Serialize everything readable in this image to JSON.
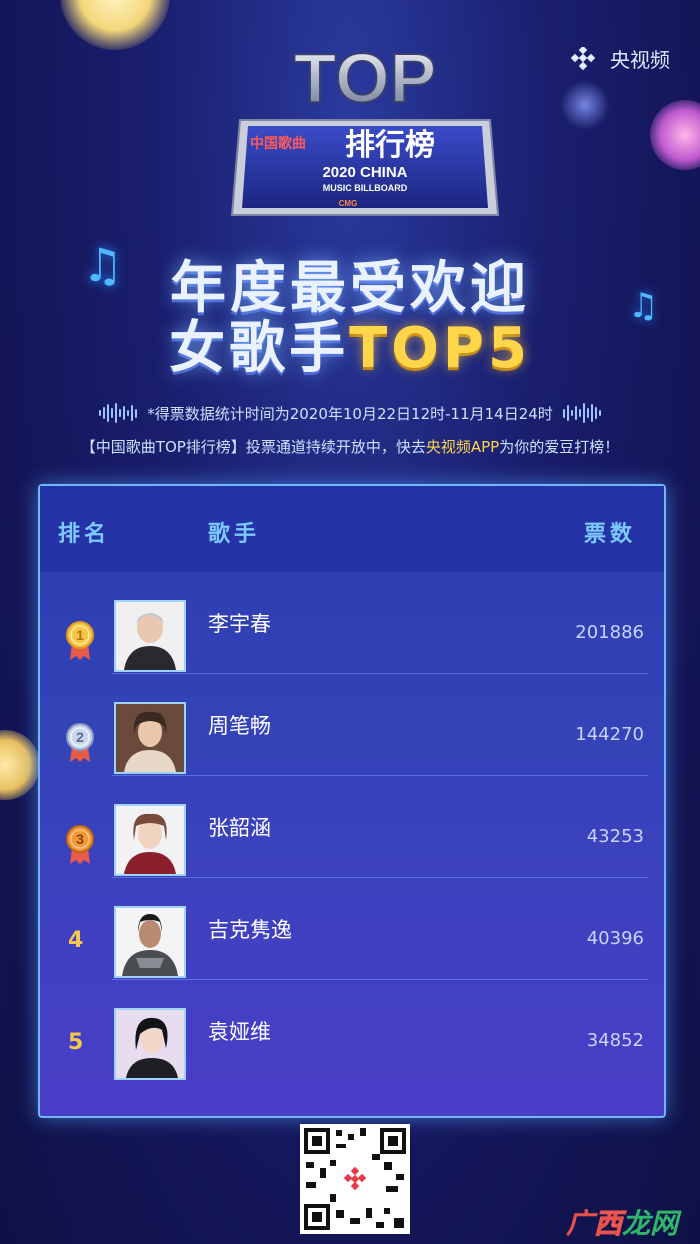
{
  "brand": {
    "name": "央视频",
    "icon": "cctv-video-logo-icon"
  },
  "logo": {
    "top": "TOP",
    "subtitle_small": "中国歌曲",
    "subtitle_big": "排行榜",
    "year_line": "2020 CHINA",
    "en_line": "MUSIC BILLBOARD",
    "org": "CMG"
  },
  "title": {
    "line1": "年度最受欢迎",
    "line2_prefix": "女歌手",
    "line2_highlight": "TOP5"
  },
  "stat_note": "*得票数据统计时间为2020年10月22日12时-11月14日24时",
  "promo": {
    "prefix": "【中国歌曲TOP排行榜】投票通道持续开放中，快去",
    "highlight": "央视频APP",
    "suffix": "为你的爱豆打榜！"
  },
  "table": {
    "headers": {
      "rank": "排名",
      "singer": "歌手",
      "votes": "票数"
    },
    "rows": [
      {
        "rank": "1",
        "name": "李宇春",
        "votes": "201886",
        "medal": "gold"
      },
      {
        "rank": "2",
        "name": "周笔畅",
        "votes": "144270",
        "medal": "silver"
      },
      {
        "rank": "3",
        "name": "张韶涵",
        "votes": "43253",
        "medal": "bronze"
      },
      {
        "rank": "4",
        "name": "吉克隽逸",
        "votes": "40396",
        "medal": ""
      },
      {
        "rank": "5",
        "name": "袁娅维",
        "votes": "34852",
        "medal": ""
      }
    ]
  },
  "watermark": {
    "c1": "广",
    "c2": "西",
    "c3": "龙网"
  },
  "colors": {
    "accent": "#7ec9ff",
    "gold": "#ffd54a",
    "panel_border": "#6fb8ff"
  }
}
